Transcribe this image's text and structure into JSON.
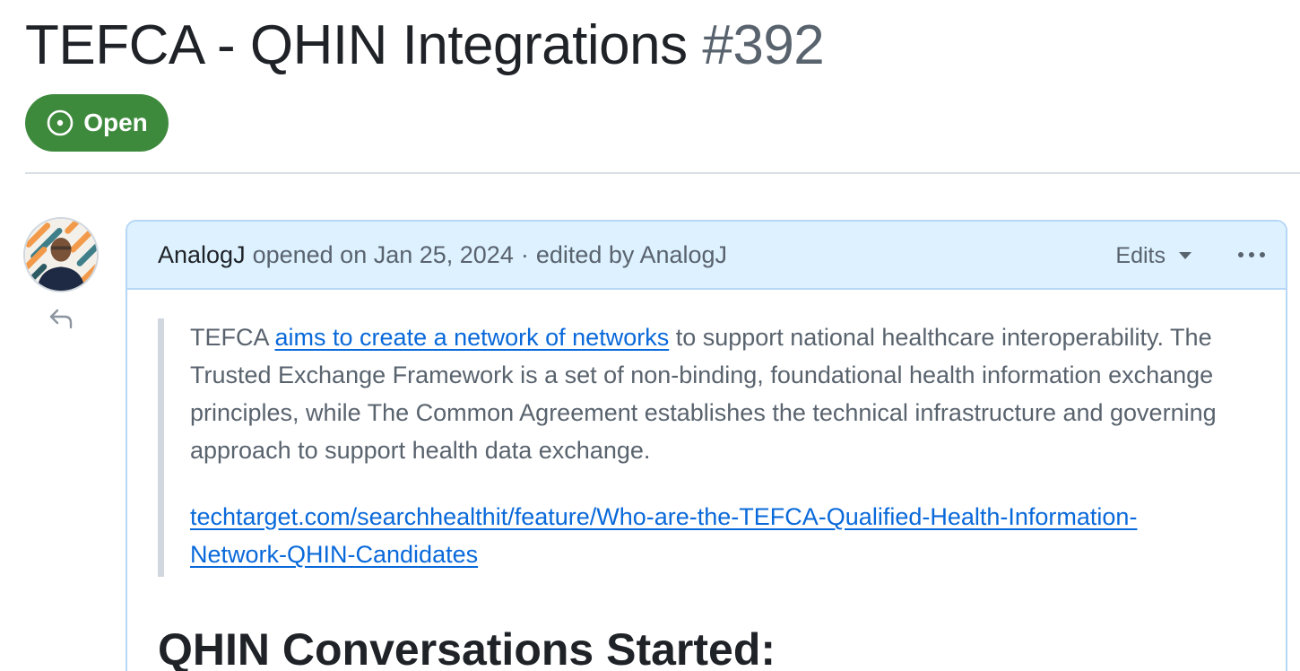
{
  "issue": {
    "title": "TEFCA - QHIN Integrations",
    "number": "#392",
    "state": "Open"
  },
  "comment": {
    "author": "AnalogJ",
    "opened_text": "opened on Jan 25, 2024",
    "separator": "·",
    "edited_text": "edited by AnalogJ",
    "edits_label": "Edits",
    "quote": {
      "before_link": "TEFCA ",
      "link_text": "aims to create a network of networks",
      "after_link": " to support national healthcare interoperability. The Trusted Exchange Framework is a set of non-binding, foundational health information exchange principles, while The Common Agreement establishes the technical infrastructure and governing approach to support health data exchange.",
      "source_url_line1": "techtarget.com/searchhealthit/feature/Who-are-the-TEFCA-Qualified-Health-Information-",
      "source_url_line2": "Network-QHIN-Candidates"
    },
    "heading": "QHIN Conversations Started:"
  },
  "icons": [
    "issue-opened-icon",
    "reply-icon",
    "triangle-down-icon",
    "kebab-horizontal-icon"
  ],
  "colors": {
    "open_badge": "#3e8a3d",
    "header_bg": "#ddf1ff",
    "border": "#b6d7f5",
    "link": "#0969da"
  }
}
